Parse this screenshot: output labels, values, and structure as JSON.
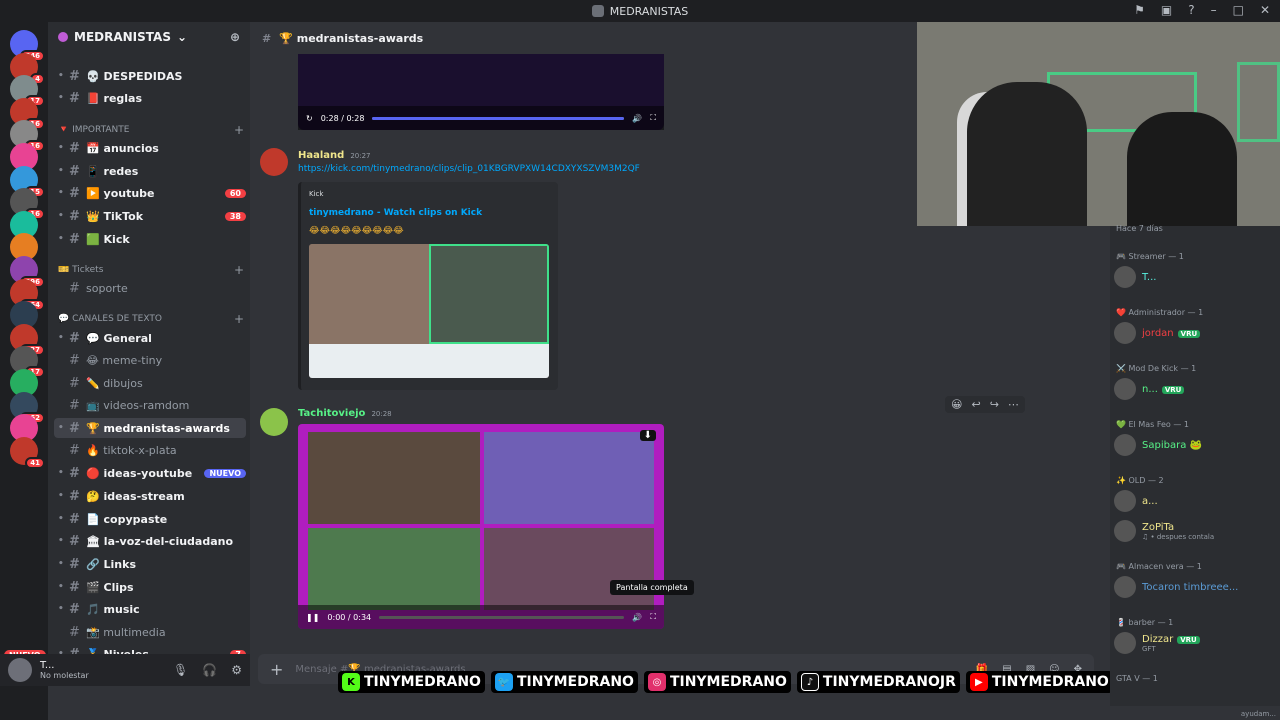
{
  "window": {
    "title": "MEDRANISTAS"
  },
  "servers": {
    "badges": [
      "346",
      "4",
      "17",
      "16",
      "16",
      "",
      "15",
      "16",
      "",
      "",
      "296",
      "264",
      "",
      "327",
      "17",
      "",
      "162",
      "",
      "41"
    ],
    "nuevo": "NUEVO"
  },
  "guild": {
    "name": "MEDRANISTAS"
  },
  "channels": [
    {
      "label": "💀 DESPEDIDAS",
      "bold": true
    },
    {
      "label": "📕 reglas",
      "bold": true
    },
    {
      "cat": "🔻 IMPORTANTE"
    },
    {
      "label": "📅 anuncios",
      "bold": true
    },
    {
      "label": "📱 redes",
      "bold": true
    },
    {
      "label": "▶️ youtube",
      "bold": true,
      "badge": "60"
    },
    {
      "label": "👑 TikTok",
      "bold": true,
      "badge": "38"
    },
    {
      "label": "🟩 Kick",
      "bold": true
    },
    {
      "cat": "🎫 Tickets"
    },
    {
      "label": "soporte",
      "bold": false
    },
    {
      "cat": "💬 CANALES DE TEXTO"
    },
    {
      "label": "💬 General",
      "bold": true
    },
    {
      "label": "😂 meme-tiny",
      "bold": false
    },
    {
      "label": "✏️ dibujos",
      "bold": false
    },
    {
      "label": "📺 videos-ramdom",
      "bold": false
    },
    {
      "label": "🏆 medranistas-awards",
      "bold": true,
      "active": true
    },
    {
      "label": "🔥 tiktok-x-plata",
      "bold": false
    },
    {
      "label": "🔴 ideas-youtube",
      "bold": true,
      "badge": "NUEVO"
    },
    {
      "label": "🤔 ideas-stream",
      "bold": true
    },
    {
      "label": "📄 copypaste",
      "bold": true
    },
    {
      "label": "🏛 la-voz-del-ciudadano",
      "bold": true
    },
    {
      "label": "🔗 Links",
      "bold": true
    },
    {
      "label": "🎬 Clips",
      "bold": true
    },
    {
      "label": "🎵 music",
      "bold": true
    },
    {
      "label": "📸 multimedia",
      "bold": false
    },
    {
      "label": "🏅 Niveles",
      "bold": true,
      "badge": "7"
    }
  ],
  "user": {
    "name": "T...",
    "status": "No molestar"
  },
  "chat": {
    "channel": "🏆 medranistas-awards",
    "video1": {
      "time": "0:28 / 0:28",
      "progress": 1.0
    },
    "msg1": {
      "author": "Haaland",
      "time": "20:27",
      "link": "https://kick.com/tinymedrano/clips/clip_01KBGRVPXW14CDXYXSZVM3M2QF"
    },
    "embed": {
      "provider": "Kick",
      "title": "tinymedrano - Watch clips on Kick",
      "emojis": "😂😂😂😂😂😂😂😂😂"
    },
    "msg2": {
      "author": "Tachitoviejo",
      "time": "20:28"
    },
    "video2": {
      "time": "0:00 / 0:34",
      "progress": 0.0
    },
    "tooltip": "Pantalla completa",
    "composer_placeholder": "Mensaje #🏆 medranistas-awards"
  },
  "socials": [
    "TINYMEDRANO",
    "TINYMEDRANO",
    "TINYMEDRANO",
    "TINYMEDRANOJR",
    "TINYMEDRANO"
  ],
  "members": {
    "top": "Hace 7 días",
    "groups": [
      {
        "head": "🎮 Streamer — 1",
        "rows": [
          {
            "name": "T...",
            "color": "#57f2e1"
          }
        ]
      },
      {
        "head": "❤️ Administrador — 1",
        "rows": [
          {
            "name": "jordan",
            "color": "#f23f43",
            "tag": "VRU"
          }
        ]
      },
      {
        "head": "⚔️ Mod De Kick — 1",
        "rows": [
          {
            "name": "n...",
            "color": "#57f287",
            "tag": "VRU"
          }
        ]
      },
      {
        "head": "💚 El Mas Feo — 1",
        "rows": [
          {
            "name": "Sapibara 🐸",
            "color": "#57f287"
          }
        ]
      },
      {
        "head": "✨ OLD — 2",
        "rows": [
          {
            "name": "a...",
            "color": "#f0e68c"
          },
          {
            "name": "ZoPiTa",
            "color": "#f0e68c",
            "sub": "♫ • despues contala"
          }
        ]
      },
      {
        "head": "🎮 Almacen vera — 1",
        "rows": [
          {
            "name": "Tocaron timbreee...",
            "color": "#5b9bd5"
          }
        ]
      },
      {
        "head": "💈 barber — 1",
        "rows": [
          {
            "name": "Dizzar",
            "color": "#f0e68c",
            "tag": "VRU",
            "sub": "GFT"
          }
        ]
      },
      {
        "head": "GTA V — 1",
        "rows": []
      }
    ]
  },
  "footer": "ayudam..."
}
